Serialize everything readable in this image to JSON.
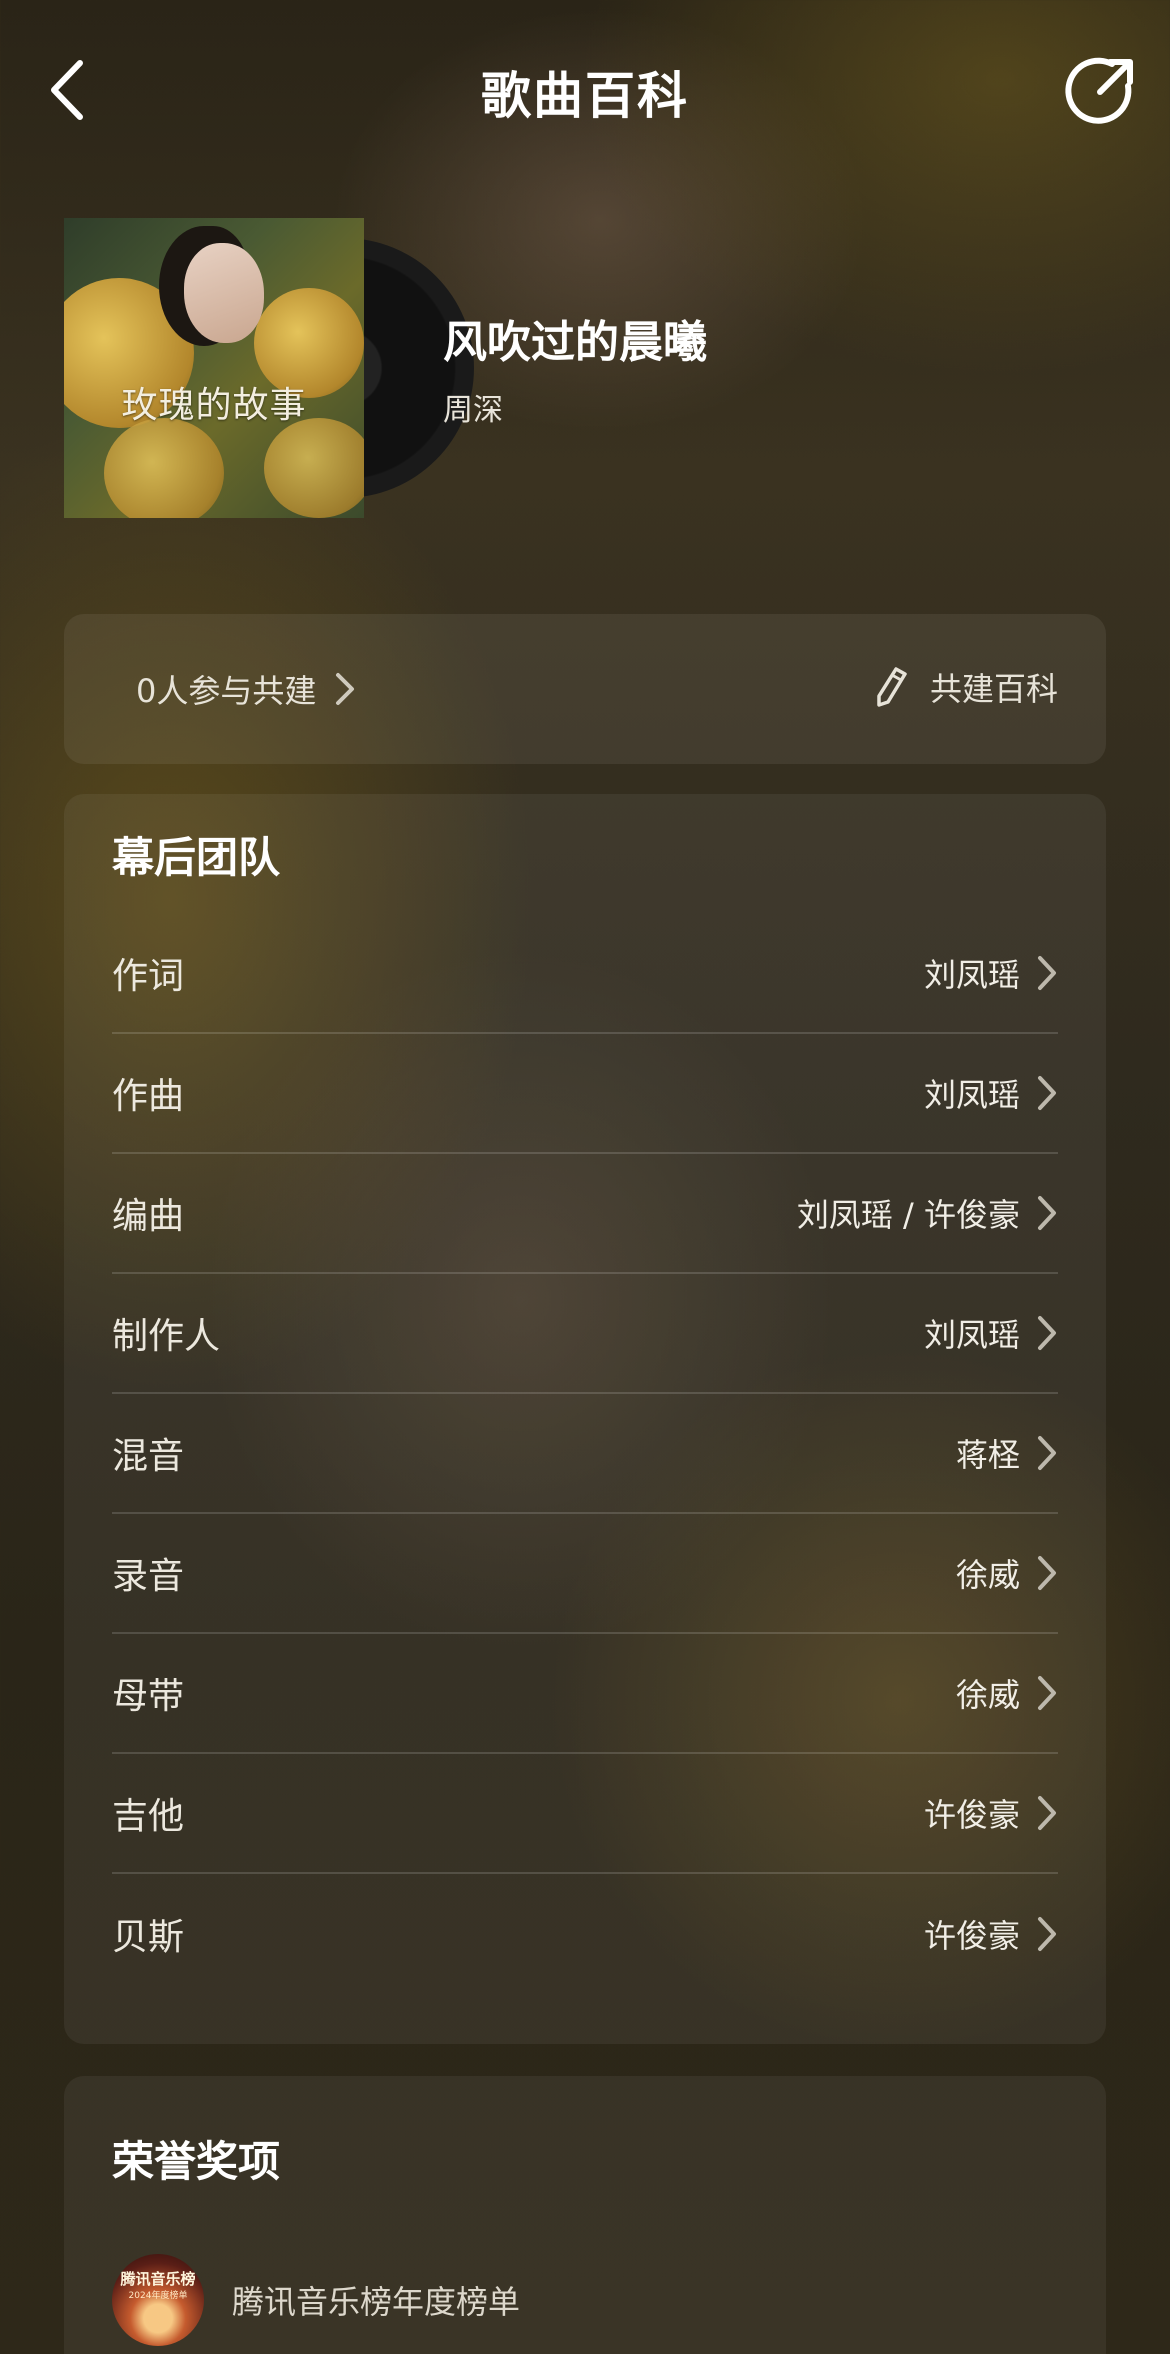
{
  "header": {
    "title": "歌曲百科"
  },
  "song": {
    "title": "风吹过的晨曦",
    "artist": "周深",
    "cover_text": "玫瑰的故事"
  },
  "cobuild": {
    "participants": "0人参与共建",
    "action_label": "共建百科"
  },
  "team": {
    "title": "幕后团队",
    "rows": [
      {
        "role": "作词",
        "names": "刘凤瑶"
      },
      {
        "role": "作曲",
        "names": "刘凤瑶"
      },
      {
        "role": "编曲",
        "names": "刘凤瑶 / 许俊豪"
      },
      {
        "role": "制作人",
        "names": "刘凤瑶"
      },
      {
        "role": "混音",
        "names": "蒋柽"
      },
      {
        "role": "录音",
        "names": "徐威"
      },
      {
        "role": "母带",
        "names": "徐威"
      },
      {
        "role": "吉他",
        "names": "许俊豪"
      },
      {
        "role": "贝斯",
        "names": "许俊豪"
      }
    ]
  },
  "honors": {
    "title": "荣誉奖项",
    "items": [
      {
        "label": "腾讯音乐榜年度榜单",
        "logo_text": "腾讯音乐榜",
        "logo_sub": "2024年度榜单"
      }
    ]
  }
}
